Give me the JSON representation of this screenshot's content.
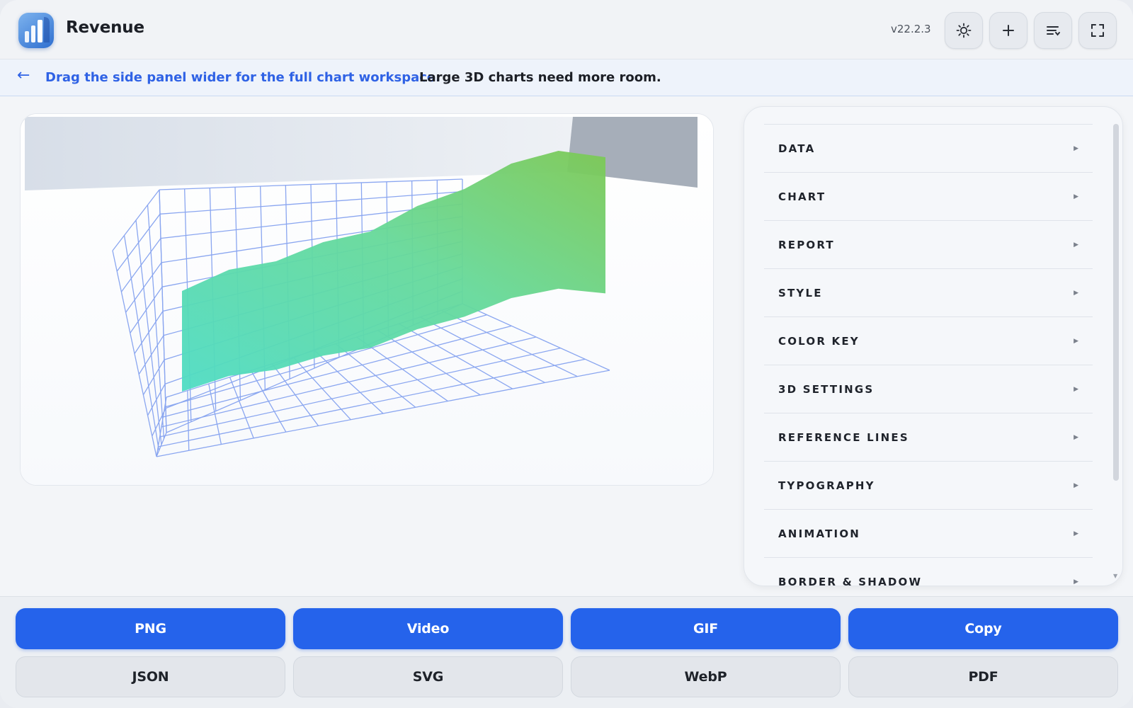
{
  "header": {
    "title": "Revenue",
    "version": "v22.2.3",
    "icons": [
      "sun-icon",
      "plus-icon",
      "sort-list-icon",
      "fullscreen-icon"
    ]
  },
  "banner": {
    "arrow": "←",
    "link": "Drag the side panel wider for the full chart workspace.",
    "message": "Large 3D charts need more room."
  },
  "panel": {
    "items": [
      {
        "label": "DATA"
      },
      {
        "label": "CHART"
      },
      {
        "label": "REPORT"
      },
      {
        "label": "STYLE"
      },
      {
        "label": "COLOR KEY"
      },
      {
        "label": "3D SETTINGS"
      },
      {
        "label": "REFERENCE LINES"
      },
      {
        "label": "TYPOGRAPHY"
      },
      {
        "label": "ANIMATION"
      },
      {
        "label": "BORDER & SHADOW"
      }
    ]
  },
  "export": {
    "primary": [
      "PNG",
      "Video",
      "GIF",
      "Copy"
    ],
    "secondary": [
      "JSON",
      "SVG",
      "WebP",
      "PDF"
    ]
  },
  "colors": {
    "accent": "#2563eb",
    "surface_low": "#4fdcc4",
    "surface_high": "#74c95c",
    "grid": "#8aa6f0"
  },
  "chart_data": {
    "type": "area",
    "surface_profile": [
      0.32,
      0.42,
      0.46,
      0.55,
      0.6,
      0.72,
      0.8,
      0.92,
      0.98,
      0.95
    ]
  }
}
